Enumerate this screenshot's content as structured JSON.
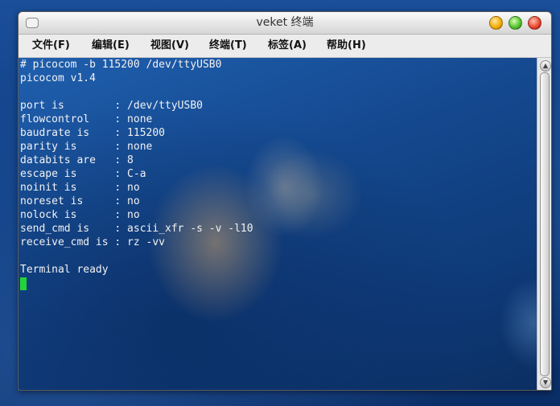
{
  "window": {
    "title": "veket 终端",
    "buttons": {
      "minimize_icon": "minimize-icon",
      "maximize_icon": "maximize-icon",
      "close_icon": "close-icon"
    }
  },
  "menu": {
    "items": [
      {
        "label": "文件(F)"
      },
      {
        "label": "编辑(E)"
      },
      {
        "label": "视图(V)"
      },
      {
        "label": "终端(T)"
      },
      {
        "label": "标签(A)"
      },
      {
        "label": "帮助(H)"
      }
    ]
  },
  "terminal": {
    "lines": [
      "# picocom -b 115200 /dev/ttyUSB0",
      "picocom v1.4",
      "",
      "port is        : /dev/ttyUSB0",
      "flowcontrol    : none",
      "baudrate is    : 115200",
      "parity is      : none",
      "databits are   : 8",
      "escape is      : C-a",
      "noinit is      : no",
      "noreset is     : no",
      "nolock is      : no",
      "send_cmd is    : ascii_xfr -s -v -l10",
      "receive_cmd is : rz -vv",
      "",
      "Terminal ready"
    ],
    "cursor_color": "#23d33a"
  },
  "scrollbar": {
    "up_icon": "scroll-up-arrow-icon",
    "down_icon": "scroll-down-arrow-icon"
  }
}
